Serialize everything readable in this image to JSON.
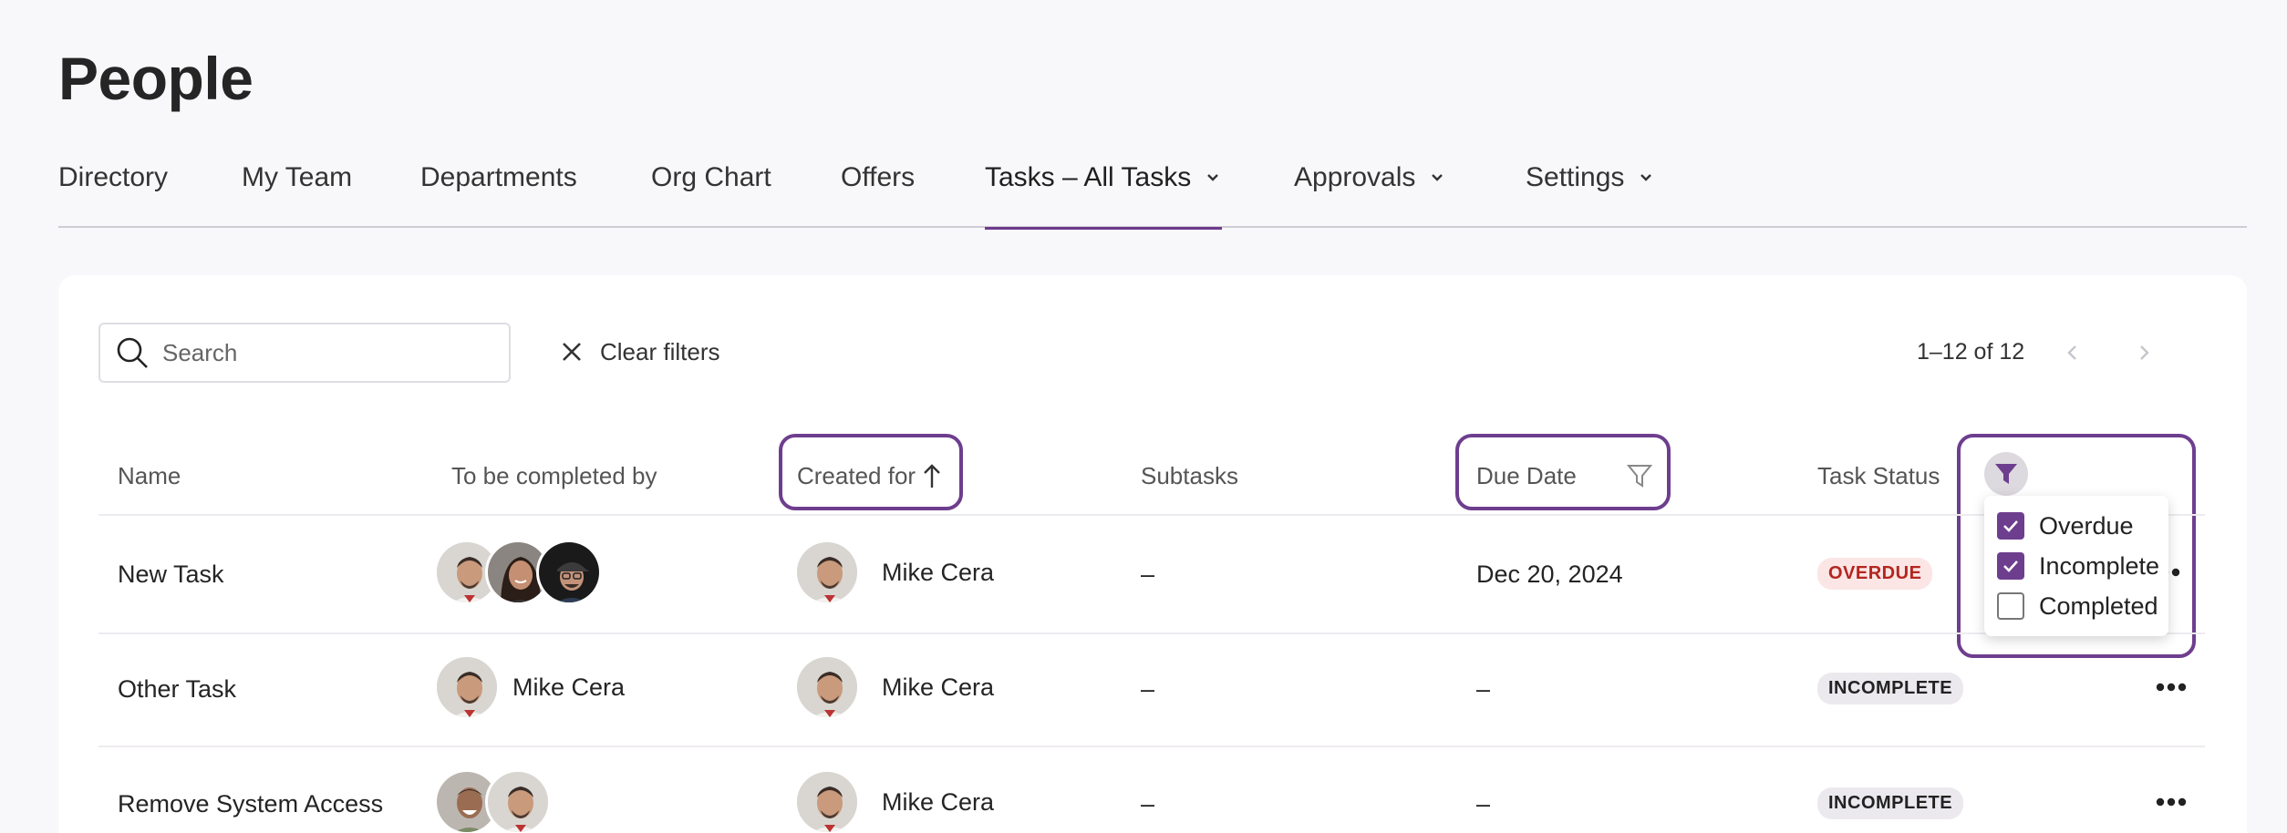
{
  "page": {
    "title": "People"
  },
  "nav": {
    "items": [
      {
        "label": "Directory"
      },
      {
        "label": "My Team"
      },
      {
        "label": "Departments"
      },
      {
        "label": "Org Chart"
      },
      {
        "label": "Offers"
      },
      {
        "label": "Tasks – All Tasks",
        "active": true
      },
      {
        "label": "Approvals"
      },
      {
        "label": "Settings"
      }
    ]
  },
  "toolbar": {
    "search_placeholder": "Search",
    "clear_filters": "Clear filters",
    "pagination": "1–12 of 12"
  },
  "table": {
    "columns": {
      "name": "Name",
      "completed_by": "To be completed by",
      "created_for": "Created for",
      "subtasks": "Subtasks",
      "due_date": "Due Date",
      "task_status": "Task Status"
    },
    "rows": [
      {
        "name": "New Task",
        "completed_by": "",
        "created_for": "Mike Cera",
        "subtasks": "–",
        "due_date": "Dec 20, 2024",
        "status": "OVERDUE"
      },
      {
        "name": "Other Task",
        "completed_by": "Mike Cera",
        "created_for": "Mike Cera",
        "subtasks": "–",
        "due_date": "–",
        "status": "INCOMPLETE"
      },
      {
        "name": "Remove System Access",
        "completed_by": "",
        "created_for": "Mike Cera",
        "subtasks": "–",
        "due_date": "–",
        "status": "INCOMPLETE"
      }
    ]
  },
  "status_filter": {
    "options": [
      {
        "label": "Overdue",
        "checked": true
      },
      {
        "label": "Incomplete",
        "checked": true
      },
      {
        "label": "Completed",
        "checked": false
      }
    ]
  },
  "colors": {
    "accent": "#6e3e8e",
    "overdue_bg": "#fbe5e5",
    "overdue_text": "#b3261e",
    "incomplete_bg": "#ebe9ee"
  }
}
